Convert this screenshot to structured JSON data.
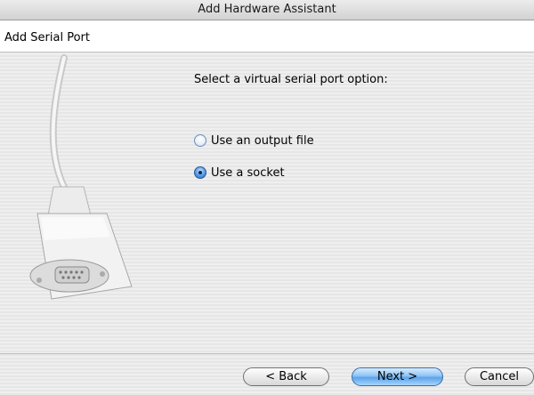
{
  "window": {
    "title": "Add Hardware Assistant"
  },
  "header": {
    "title": "Add Serial Port"
  },
  "content": {
    "prompt": "Select a virtual serial port option:",
    "options": [
      {
        "label": "Use an output file",
        "selected": false
      },
      {
        "label": "Use a socket",
        "selected": true
      }
    ]
  },
  "buttons": {
    "back": "< Back",
    "next": "Next >",
    "cancel": "Cancel"
  },
  "icons": {
    "illustration": "serial-cable-icon"
  },
  "colors": {
    "default_button": "#5aa3ea",
    "radio_selected": "#1f66c8"
  }
}
